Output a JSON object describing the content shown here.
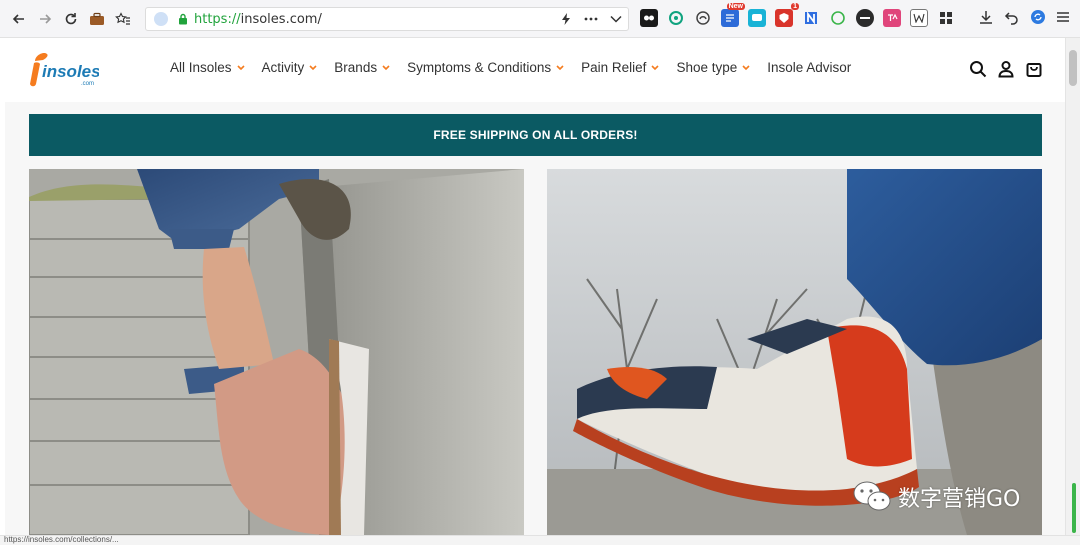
{
  "browser": {
    "url_scheme": "https://",
    "url_host": "insoles.com/",
    "new_badge": "New",
    "abp_badge": "1"
  },
  "site": {
    "brand": "insoles",
    "brand_sub": ".com",
    "brand_color": "#f57c1f",
    "accent_color": "#0b5a63",
    "nav": [
      {
        "label": "All Insoles",
        "has_dropdown": true
      },
      {
        "label": "Activity",
        "has_dropdown": true
      },
      {
        "label": "Brands",
        "has_dropdown": true
      },
      {
        "label": "Symptoms & Conditions",
        "has_dropdown": true
      },
      {
        "label": "Pain Relief",
        "has_dropdown": true
      },
      {
        "label": "Shoe type",
        "has_dropdown": true
      },
      {
        "label": "Insole Advisor",
        "has_dropdown": false
      }
    ],
    "header_icons": [
      "search-icon",
      "account-icon",
      "cart-icon"
    ]
  },
  "banner": {
    "text": "FREE SHIPPING ON ALL ORDERS!"
  },
  "watermark": {
    "text": "数字营销GO"
  },
  "status": {
    "link_preview": "https://insoles.com/collections/..."
  }
}
